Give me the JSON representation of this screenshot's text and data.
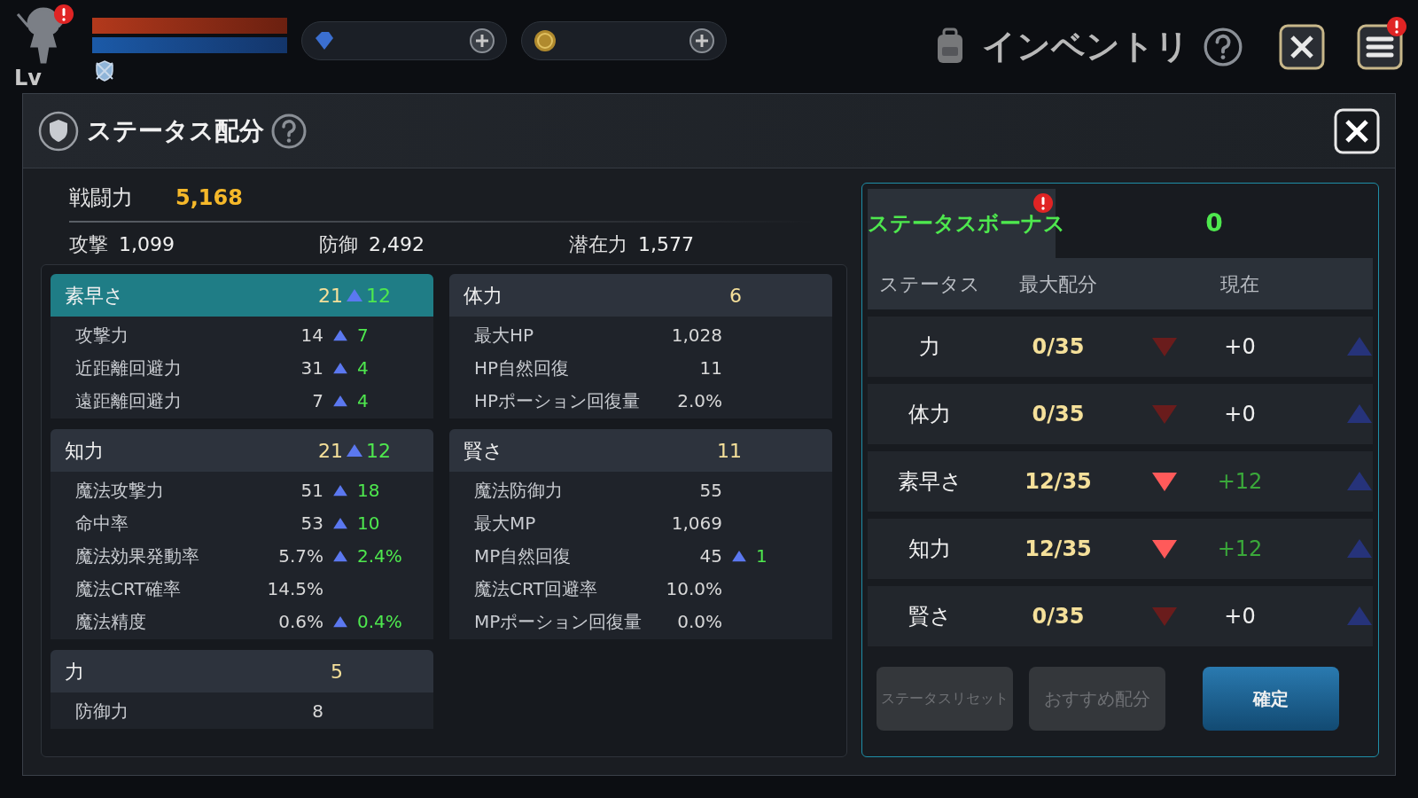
{
  "top_bar": {
    "level_label": "Lv",
    "alert": true,
    "menu_alert": true,
    "title": "インベントリ"
  },
  "dialog": {
    "title": "ステータス配分",
    "power": {
      "label": "戦闘力",
      "value": "5,168"
    },
    "stats": [
      {
        "label": "攻撃",
        "value": "1,099"
      },
      {
        "label": "防御",
        "value": "2,492"
      },
      {
        "label": "潜在力",
        "value": "1,577"
      }
    ],
    "columns": [
      [
        {
          "name": "素早さ",
          "value": "21",
          "bonus": "12",
          "selected": true,
          "rows": [
            {
              "label": "攻撃力",
              "value": "14",
              "bonus": "7"
            },
            {
              "label": "近距離回避力",
              "value": "31",
              "bonus": "4"
            },
            {
              "label": "遠距離回避力",
              "value": "7",
              "bonus": "4"
            }
          ]
        },
        {
          "name": "知力",
          "value": "21",
          "bonus": "12",
          "selected": false,
          "rows": [
            {
              "label": "魔法攻撃力",
              "value": "51",
              "bonus": "18"
            },
            {
              "label": "命中率",
              "value": "53",
              "bonus": "10"
            },
            {
              "label": "魔法効果発動率",
              "value": "5.7%",
              "bonus": "2.4%"
            },
            {
              "label": "魔法CRT確率",
              "value": "14.5%"
            },
            {
              "label": "魔法精度",
              "value": "0.6%",
              "bonus": "0.4%"
            }
          ]
        },
        {
          "name": "力",
          "value": "5",
          "selected": false,
          "rows": [
            {
              "label": "防御力",
              "value": "8"
            }
          ]
        }
      ],
      [
        {
          "name": "体力",
          "value": "6",
          "selected": false,
          "rows": [
            {
              "label": "最大HP",
              "value": "1,028"
            },
            {
              "label": "HP自然回復",
              "value": "11"
            },
            {
              "label": "HPポーション回復量",
              "value": "2.0%"
            }
          ]
        },
        {
          "name": "賢さ",
          "value": "11",
          "selected": false,
          "rows": [
            {
              "label": "魔法防御力",
              "value": "55"
            },
            {
              "label": "最大MP",
              "value": "1,069"
            },
            {
              "label": "MP自然回復",
              "value": "45",
              "bonus": "1"
            },
            {
              "label": "魔法CRT回避率",
              "value": "10.0%"
            },
            {
              "label": "MPポーション回復量",
              "value": "0.0%"
            }
          ]
        }
      ]
    ],
    "bonus_panel": {
      "label": "ステータスボーナス",
      "alert": true,
      "value": "0",
      "headers": [
        "ステータス",
        "最大配分",
        "現在"
      ],
      "rows": [
        {
          "name": "力",
          "max": "0/35",
          "current": "+0",
          "allocated": false
        },
        {
          "name": "体力",
          "max": "0/35",
          "current": "+0",
          "allocated": false
        },
        {
          "name": "素早さ",
          "max": "12/35",
          "current": "+12",
          "allocated": true
        },
        {
          "name": "知力",
          "max": "12/35",
          "current": "+12",
          "allocated": true
        },
        {
          "name": "賢さ",
          "max": "0/35",
          "current": "+0",
          "allocated": false
        }
      ],
      "buttons": [
        {
          "label": "ステータスリセット",
          "disabled": true
        },
        {
          "label": "おすすめ配分",
          "disabled": true
        },
        {
          "label": "確定",
          "disabled": false
        }
      ]
    }
  }
}
